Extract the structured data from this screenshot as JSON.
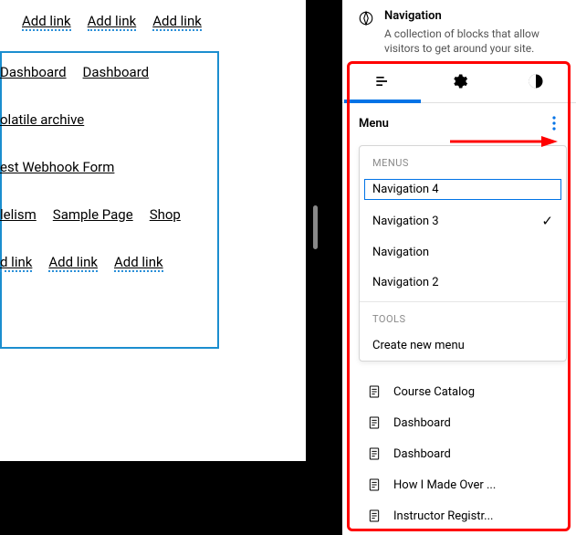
{
  "canvas": {
    "row1": [
      "Add link",
      "Add link",
      "Add link"
    ],
    "row2": [
      "Dashboard",
      "Dashboard"
    ],
    "row3": [
      "olatile archive"
    ],
    "row4": [
      "est Webhook Form"
    ],
    "row5": [
      "lelism",
      "Sample Page",
      "Shop"
    ],
    "row6": [
      "d link",
      "Add link",
      "Add link"
    ]
  },
  "header": {
    "title": "Navigation",
    "description": "A collection of blocks that allow visitors to get around your site."
  },
  "tabs": {
    "list": "list",
    "settings": "settings",
    "styles": "styles"
  },
  "menu": {
    "label": "Menu"
  },
  "dropdown": {
    "menus_label": "MENUS",
    "tools_label": "TOOLS",
    "items": {
      "nav4": "Navigation 4",
      "nav3": "Navigation 3",
      "nav": "Navigation",
      "nav2": "Navigation 2"
    },
    "create": "Create new menu"
  },
  "navlist": {
    "i0": "Course Catalog",
    "i1": "Dashboard",
    "i2": "Dashboard",
    "i3": "How I Made Over ...",
    "i4": "Instructor Registr..."
  }
}
